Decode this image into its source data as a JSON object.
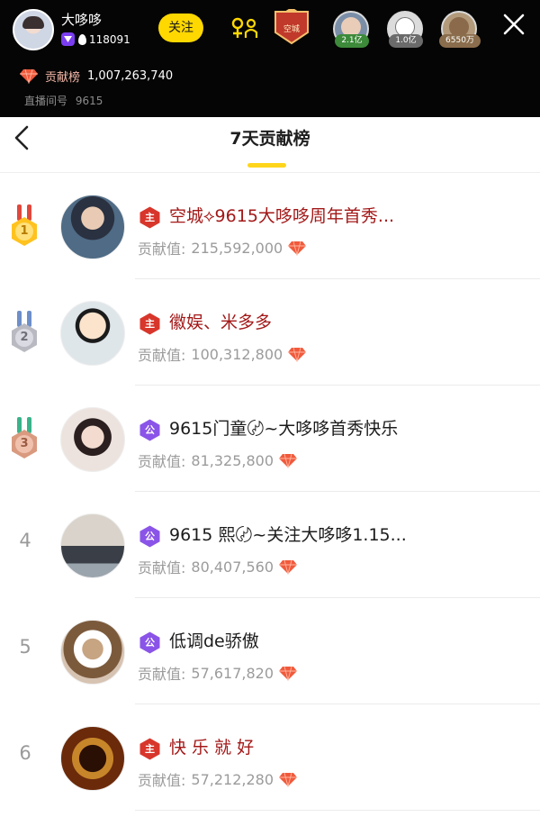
{
  "colors": {
    "accent_yellow": "#ffd800",
    "underline_yellow": "#ffd51c",
    "gem_red": "#f05a3c",
    "name_red": "#a31818",
    "badge_red": "#d8362b",
    "badge_purple": "#8a54e8",
    "topbar_bg": "#050505"
  },
  "host": {
    "name": "大哆哆",
    "fans": "118091",
    "follow_label": "关注",
    "shield_label": "空城",
    "top_viewers": [
      {
        "tag": "2.1亿"
      },
      {
        "tag": "1.0亿"
      },
      {
        "tag": "6550万"
      }
    ],
    "contribution_label": "贡献榜",
    "contribution_total": "1,007,263,740",
    "room_label": "直播间号",
    "room_number": "9615"
  },
  "page": {
    "title": "7天贡献榜"
  },
  "list": [
    {
      "rank": "1",
      "medal": "gold",
      "badge_type": "主",
      "badge_color": "red",
      "name_color": "red",
      "name": "空城⟡9615大哆哆周年首秀...",
      "contrib_label": "贡献值:",
      "contrib_value": "215,592,000"
    },
    {
      "rank": "2",
      "medal": "silver",
      "badge_type": "主",
      "badge_color": "red",
      "name_color": "red",
      "name": "徽娱、米多多",
      "contrib_label": "贡献值:",
      "contrib_value": "100,312,800"
    },
    {
      "rank": "3",
      "medal": "bronze",
      "badge_type": "公",
      "badge_color": "purple",
      "name_color": "dark",
      "name": "9615门童〄~大哆哆首秀快乐",
      "contrib_label": "贡献值:",
      "contrib_value": "81,325,800"
    },
    {
      "rank": "4",
      "badge_type": "公",
      "badge_color": "purple",
      "name_color": "dark",
      "name": "9615 熙〄~关注大哆哆1.15...",
      "contrib_label": "贡献值:",
      "contrib_value": "80,407,560"
    },
    {
      "rank": "5",
      "badge_type": "公",
      "badge_color": "purple",
      "name_color": "dark",
      "name": "低调de骄傲",
      "contrib_label": "贡献值:",
      "contrib_value": "57,617,820"
    },
    {
      "rank": "6",
      "badge_type": "主",
      "badge_color": "red",
      "name_color": "red",
      "name": "快 乐 就 好",
      "contrib_label": "贡献值:",
      "contrib_value": "57,212,280"
    }
  ]
}
